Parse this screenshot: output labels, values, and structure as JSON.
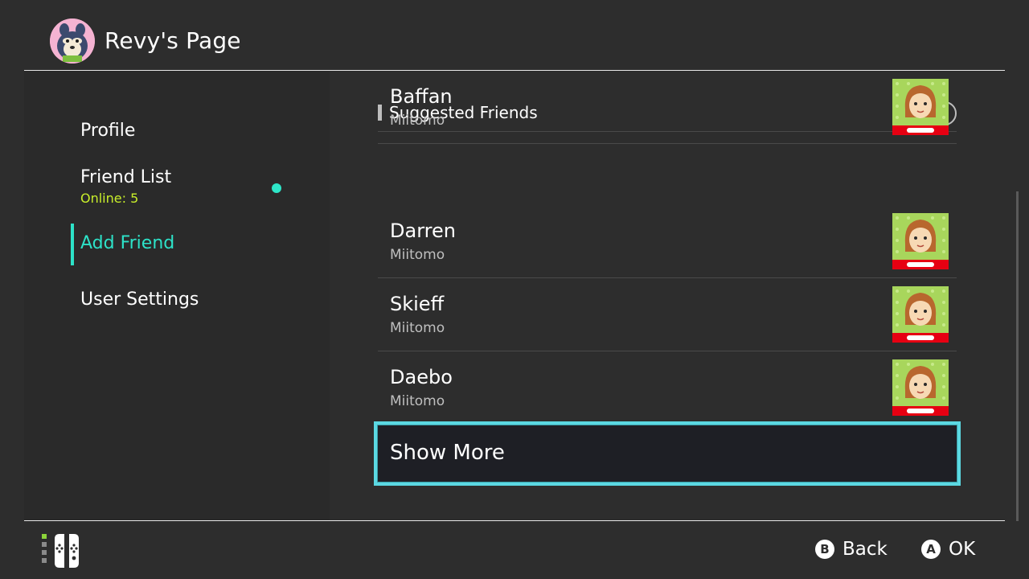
{
  "header": {
    "title": "Revy's Page",
    "avatar_icon": "mitzi-avatar-icon"
  },
  "sidebar": {
    "items": [
      {
        "label": "Profile"
      },
      {
        "label": "Friend List",
        "sub": "Online: 5"
      },
      {
        "label": "Add Friend",
        "selected": true
      },
      {
        "label": "User Settings"
      }
    ]
  },
  "content": {
    "section_title": "Suggested Friends",
    "help_icon": "?",
    "friends": [
      {
        "name": "Darren",
        "source": "Miitomo",
        "badge": "Nintendo"
      },
      {
        "name": "Skieff",
        "source": "Miitomo",
        "badge": "Nintendo"
      },
      {
        "name": "Daebo",
        "source": "Miitomo",
        "badge": "Nintendo"
      },
      {
        "name": "Baffan",
        "source": "Miitomo",
        "badge": "Nintendo"
      }
    ],
    "show_more_label": "Show More"
  },
  "footer": {
    "back": {
      "button": "B",
      "label": "Back"
    },
    "ok": {
      "button": "A",
      "label": "OK"
    }
  },
  "colors": {
    "accent_teal": "#2de2c8",
    "online_green": "#c8ee2a",
    "focus_border": "#5bd8e2",
    "background": "#2d2d2d"
  }
}
